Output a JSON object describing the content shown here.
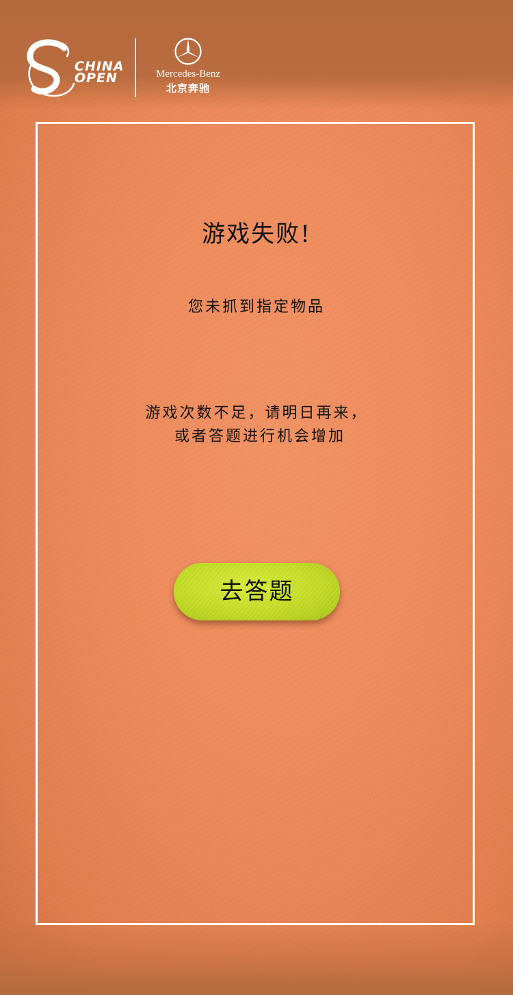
{
  "header": {
    "china_open": {
      "line1": "CHINA",
      "line2": "OPEN"
    },
    "sponsor": {
      "name": "Mercedes-Benz",
      "name_cn": "北京奔驰"
    }
  },
  "dialog": {
    "title": "游戏失败!",
    "subtitle": "您未抓到指定物品",
    "message_line1": "游戏次数不足，请明日再来，",
    "message_line2": "或者答题进行机会增加",
    "button_label": "去答题"
  },
  "colors": {
    "background": "#ec8a5a",
    "header_band": "#b4693d",
    "frame_border": "#ffffff",
    "button": "#c2dc24",
    "text": "#111111"
  },
  "icons": [
    "china-open-logo-icon",
    "mercedes-star-icon"
  ]
}
